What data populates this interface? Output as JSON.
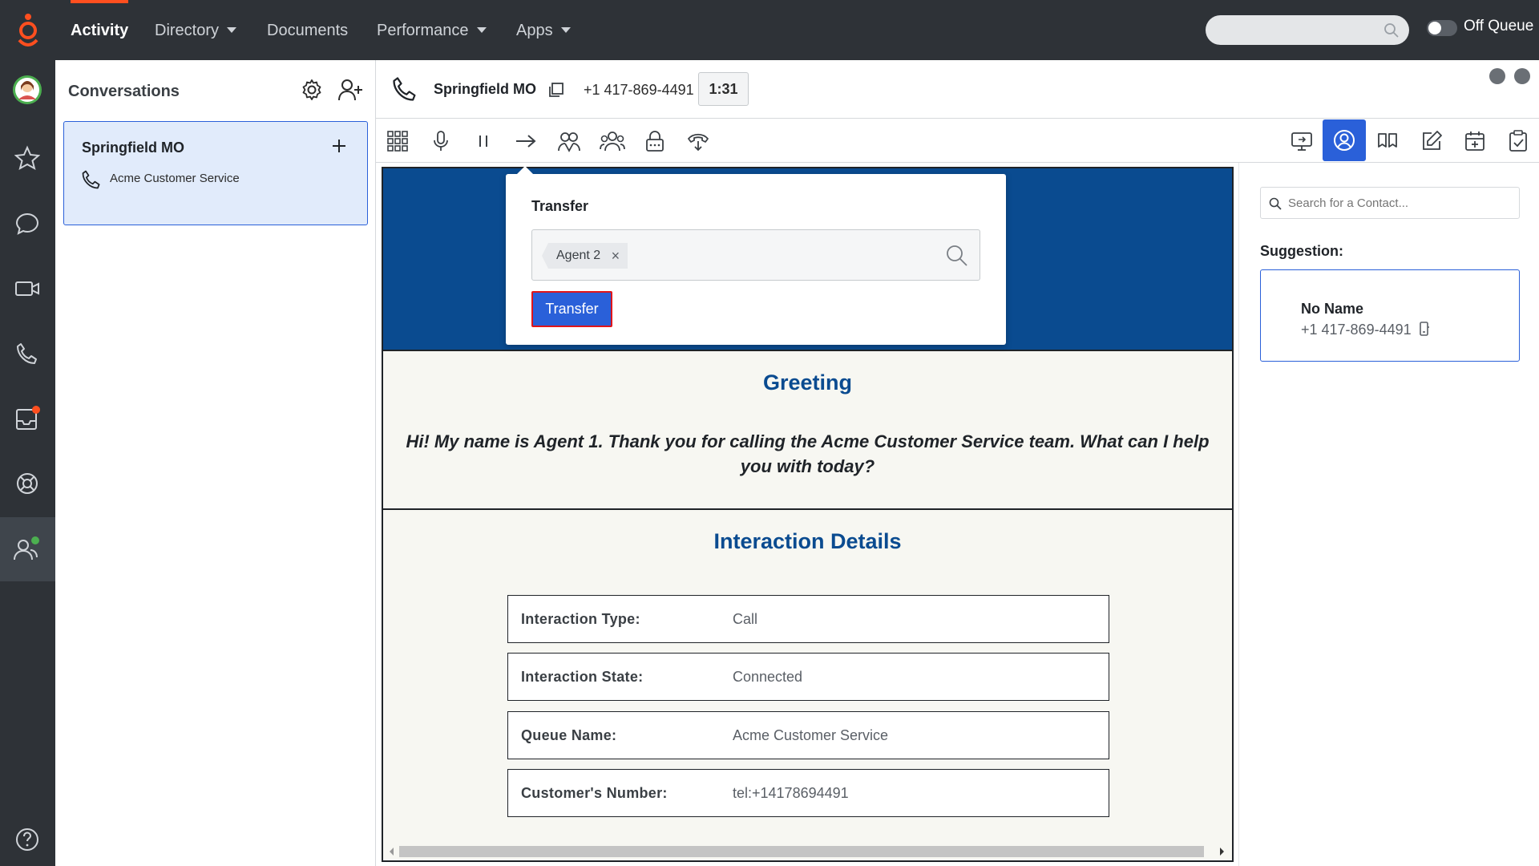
{
  "nav": {
    "items": [
      {
        "label": "Activity"
      },
      {
        "label": "Directory"
      },
      {
        "label": "Documents"
      },
      {
        "label": "Performance"
      },
      {
        "label": "Apps"
      }
    ],
    "search_placeholder": "",
    "queue_status": "Off Queue"
  },
  "conversations": {
    "title": "Conversations",
    "card": {
      "name": "Springfield MO",
      "queue": "Acme Customer Service"
    }
  },
  "call": {
    "name": "Springfield MO",
    "number": "+1 417-869-4491",
    "timer": "1:31"
  },
  "transfer": {
    "title": "Transfer",
    "chip": "Agent 2",
    "chip_remove": "×",
    "button": "Transfer"
  },
  "script": {
    "greeting_title": "Greeting",
    "greeting_text": "Hi! My name is Agent 1. Thank you for calling the Acme Customer Service team. What can I help you with today?",
    "details_title": "Interaction Details",
    "details": [
      {
        "label": "Interaction Type:",
        "value": "Call"
      },
      {
        "label": "Interaction State:",
        "value": "Connected"
      },
      {
        "label": "Queue Name:",
        "value": "Acme Customer Service"
      },
      {
        "label": "Customer's Number:",
        "value": "tel:+14178694491"
      }
    ]
  },
  "contacts": {
    "search_placeholder": "Search for a Contact...",
    "suggestion_label": "Suggestion:",
    "suggestion": {
      "name": "No Name",
      "number": "+1 417-869-4491"
    }
  },
  "colors": {
    "accent": "#2a60d9",
    "brand": "#ff4f1f",
    "banner": "#0a4b90",
    "highlight": "#e0151a"
  }
}
